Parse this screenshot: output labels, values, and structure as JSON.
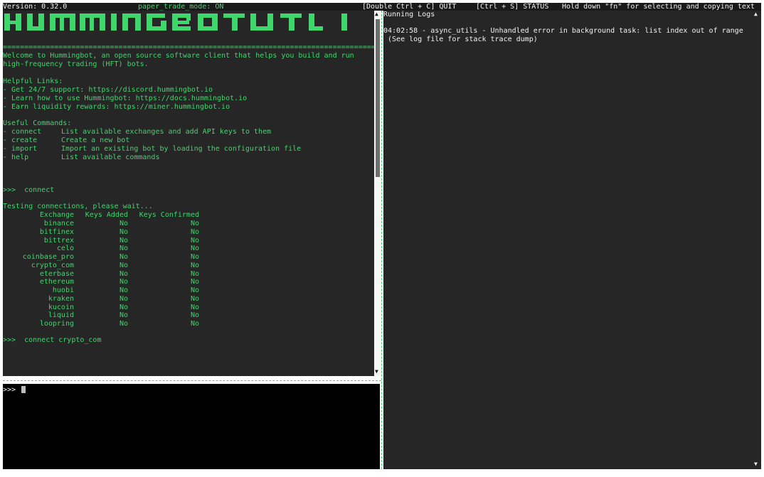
{
  "topbar": {
    "version": "Version: 0.32.0",
    "mode": "paper_trade_mode: ON",
    "quit": "[Double Ctrl + C] QUIT",
    "status": "[Ctrl + S] STATUS",
    "hint": "Hold down \"fn\" for selecting and copying text"
  },
  "output": {
    "separator": "=========================================================================================",
    "welcome_1": "Welcome to Hummingbot, an open source software client that helps you build and run",
    "welcome_2": "high-frequency trading (HFT) bots.",
    "links_title": "Helpful Links:",
    "links": [
      "- Get 24/7 support: https://discord.hummingbot.io",
      "- Learn how to use Hummingbot: https://docs.hummingbot.io",
      "- Earn liquidity rewards: https://miner.hummingbot.io"
    ],
    "commands_title": "Useful Commands:",
    "commands": [
      {
        "cmd": "- connect",
        "desc": "List available exchanges and add API keys to them"
      },
      {
        "cmd": "- create",
        "desc": "Create a new bot"
      },
      {
        "cmd": "- import",
        "desc": "Import an existing bot by loading the configuration file"
      },
      {
        "cmd": "- help",
        "desc": "List available commands"
      }
    ],
    "cmd_1": ">>>  connect",
    "testing": "Testing connections, please wait...",
    "table_headers": [
      "Exchange",
      "Keys Added",
      "Keys Confirmed"
    ],
    "table_rows": [
      {
        "exchange": "binance",
        "added": "No",
        "confirmed": "No"
      },
      {
        "exchange": "bitfinex",
        "added": "No",
        "confirmed": "No"
      },
      {
        "exchange": "bittrex",
        "added": "No",
        "confirmed": "No"
      },
      {
        "exchange": "celo",
        "added": "No",
        "confirmed": "No"
      },
      {
        "exchange": "coinbase_pro",
        "added": "No",
        "confirmed": "No"
      },
      {
        "exchange": "crypto_com",
        "added": "No",
        "confirmed": "No"
      },
      {
        "exchange": "eterbase",
        "added": "No",
        "confirmed": "No"
      },
      {
        "exchange": "ethereum",
        "added": "No",
        "confirmed": "No"
      },
      {
        "exchange": "huobi",
        "added": "No",
        "confirmed": "No"
      },
      {
        "exchange": "kraken",
        "added": "No",
        "confirmed": "No"
      },
      {
        "exchange": "kucoin",
        "added": "No",
        "confirmed": "No"
      },
      {
        "exchange": "liquid",
        "added": "No",
        "confirmed": "No"
      },
      {
        "exchange": "loopring",
        "added": "No",
        "confirmed": "No"
      }
    ],
    "cmd_2": ">>>  connect crypto_com"
  },
  "input": {
    "prompt": ">>>",
    "value": ""
  },
  "logs": {
    "title": "Running Logs",
    "entries": [
      "04:02:58 - async_utils - Unhandled error in background task: list index out of range",
      " (See log file for stack trace dump)"
    ]
  },
  "colors": {
    "accent": "#3fd66b",
    "pane_bg": "#262626",
    "input_bg": "#000000"
  },
  "icons": [
    "scroll-up-arrow-icon",
    "scroll-down-arrow-icon"
  ]
}
